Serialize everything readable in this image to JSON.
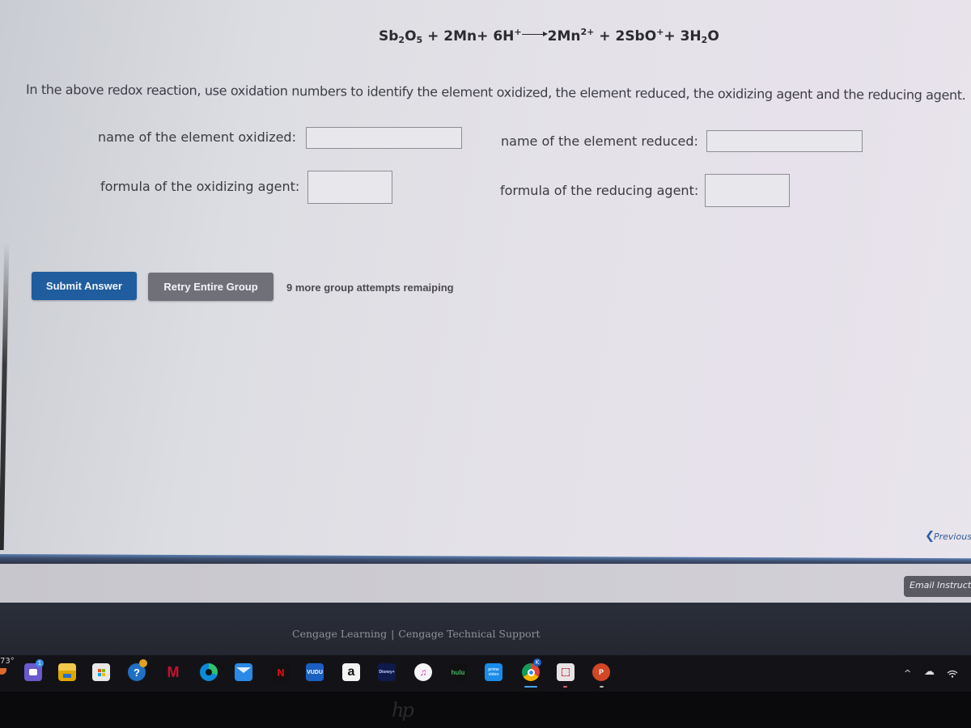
{
  "question": {
    "equation": {
      "reactants": [
        {
          "coef": "",
          "parts": [
            [
              "Sb",
              ""
            ],
            [
              "2",
              "sub"
            ],
            [
              "O",
              ""
            ],
            [
              "5",
              "sub"
            ]
          ]
        },
        {
          "coef": "2",
          "parts": [
            [
              "Mn",
              ""
            ]
          ]
        },
        {
          "coef": "6",
          "parts": [
            [
              "H",
              ""
            ],
            [
              "+",
              "sup"
            ]
          ]
        }
      ],
      "products": [
        {
          "coef": "2",
          "parts": [
            [
              "Mn",
              ""
            ],
            [
              "2+",
              "sup"
            ]
          ]
        },
        {
          "coef": "2",
          "parts": [
            [
              "SbO",
              ""
            ],
            [
              "+",
              "sup"
            ]
          ]
        },
        {
          "coef": "3",
          "parts": [
            [
              "H",
              ""
            ],
            [
              "2",
              "sub"
            ],
            [
              "O",
              ""
            ]
          ]
        }
      ],
      "text": "Sb2O5 + 2Mn+ 6H+ → 2Mn2+ + 2SbO+ + 3H2O"
    },
    "instructions": "In the above redox reaction, use oxidation numbers to identify the element oxidized, the element reduced, the oxidizing agent and the reducing agent."
  },
  "fields": {
    "element_oxidized": {
      "label": "name of the element oxidized:",
      "value": ""
    },
    "element_reduced": {
      "label": "name of the element reduced:",
      "value": ""
    },
    "oxidizing_agent": {
      "label": "formula of the oxidizing agent:",
      "value": ""
    },
    "reducing_agent": {
      "label": "formula of the reducing agent:",
      "value": ""
    }
  },
  "actions": {
    "submit_label": "Submit Answer",
    "retry_label": "Retry Entire Group",
    "attempts_text": "9 more group attempts remaiping"
  },
  "navigation": {
    "previous_label": "Previous",
    "email_label": "Email Instructor"
  },
  "footer": {
    "brand_link": "Cengage Learning",
    "separator": "|",
    "support_link": "Cengage Technical Support"
  },
  "taskbar": {
    "weather": "73°",
    "teams_badge": "1",
    "chrome_badge": "K",
    "apps": [
      {
        "name": "teams",
        "icon": "teams-chat-icon"
      },
      {
        "name": "file-explorer",
        "icon": "folder-icon"
      },
      {
        "name": "microsoft-store",
        "icon": "store-icon"
      },
      {
        "name": "get-help",
        "icon": "help-icon"
      },
      {
        "name": "mcafee",
        "icon": "mcafee-icon"
      },
      {
        "name": "edge",
        "icon": "edge-icon"
      },
      {
        "name": "mail",
        "icon": "mail-icon"
      },
      {
        "name": "netflix",
        "icon": "netflix-icon",
        "text": "N"
      },
      {
        "name": "vudu",
        "icon": "vudu-icon",
        "text": "VUDU"
      },
      {
        "name": "amazon",
        "icon": "amazon-icon",
        "text": "a"
      },
      {
        "name": "disney-plus",
        "icon": "disney-plus-icon",
        "text": "Disney+"
      },
      {
        "name": "itunes",
        "icon": "itunes-icon",
        "text": "♫"
      },
      {
        "name": "hulu",
        "icon": "hulu-icon",
        "text": "hulu"
      },
      {
        "name": "prime-video",
        "icon": "prime-video-icon",
        "text": "prime video"
      },
      {
        "name": "chrome",
        "icon": "chrome-icon"
      },
      {
        "name": "snipping-tool",
        "icon": "snipping-tool-icon"
      },
      {
        "name": "powerpoint",
        "icon": "powerpoint-icon",
        "text": "P"
      }
    ],
    "tray": {
      "chevron": "^",
      "cloud": "☁",
      "wifi": "wifi"
    }
  },
  "device": {
    "logo": "hp"
  }
}
